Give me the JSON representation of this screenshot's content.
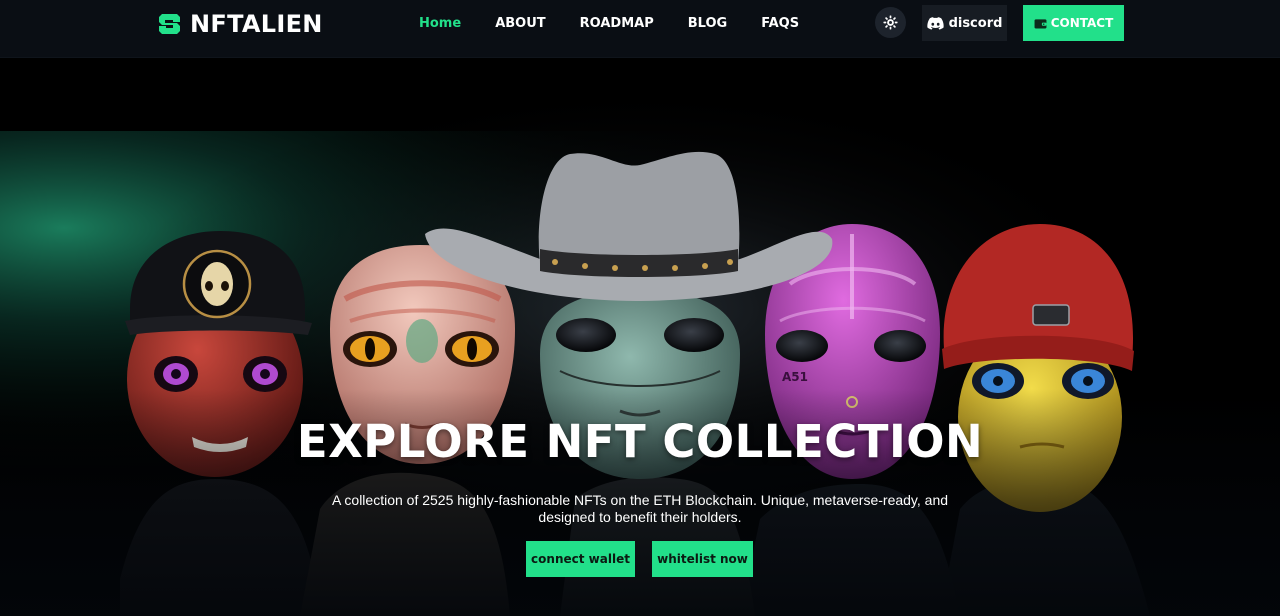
{
  "brand": {
    "name": "NFTALIEN",
    "logo_icon": "logo-s-icon",
    "accent": "#22e08a"
  },
  "nav": {
    "items": [
      {
        "label": "Home",
        "active": true
      },
      {
        "label": "ABOUT",
        "active": false
      },
      {
        "label": "ROADMAP",
        "active": false
      },
      {
        "label": "BLOG",
        "active": false
      },
      {
        "label": "FAQS",
        "active": false
      }
    ],
    "theme_toggle_icon": "sun-icon",
    "discord": {
      "label": "discord",
      "icon": "discord-icon"
    },
    "contact": {
      "label": "CONTACT",
      "icon": "wallet-icon"
    }
  },
  "hero": {
    "title": "EXPLORE NFT COLLECTION",
    "subtitle": "A collection of 2525 highly-fashionable NFTs on the ETH Blockchain. Unique, metaverse-ready, and designed to benefit their holders.",
    "buttons": {
      "connect": "connect wallet",
      "whitelist": "whitelist now"
    },
    "image": "five alien character portraits",
    "colors": {
      "background": "#000000",
      "glow": "#1d8a66"
    }
  }
}
